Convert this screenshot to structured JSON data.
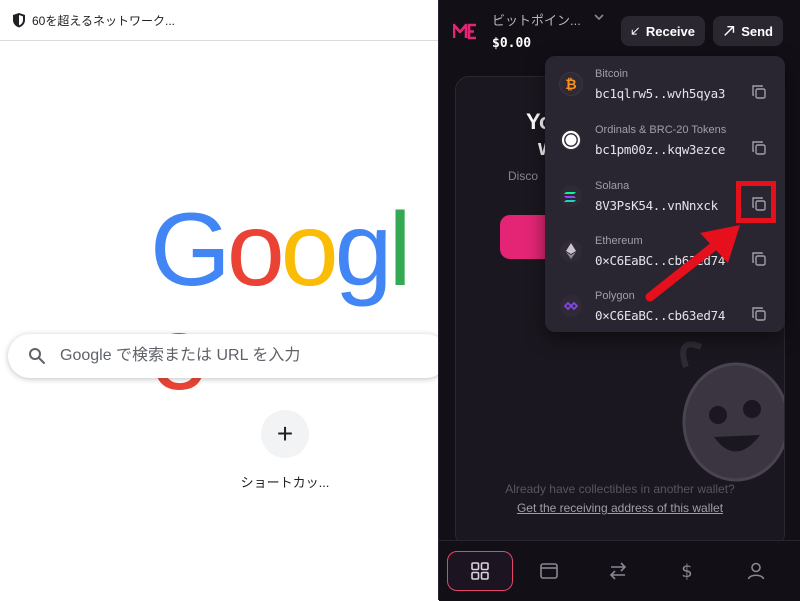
{
  "browser": {
    "tab_title": "60を超えるネットワーク...",
    "search_placeholder": "Google で検索または URL を入力",
    "logo_letters": [
      "G",
      "o",
      "o",
      "g",
      "l",
      "e"
    ],
    "logo_colors": [
      "#4285F4",
      "#EA4335",
      "#FBBC05",
      "#4285F4",
      "#34A853",
      "#EA4335"
    ],
    "shortcut_icon": "+",
    "shortcut_label": "ショートカッ..."
  },
  "wallet": {
    "account_name": "ビットポイン...",
    "balance": "$0.00",
    "receive_label": "Receive",
    "send_label": "Send",
    "brand_color": "#e42575",
    "card": {
      "title": "Yo",
      "title_line2": "w",
      "subtitle": "Disco",
      "note": "Already have collectibles in another wallet?",
      "link": "Get the receiving address of this wallet"
    },
    "addresses": [
      {
        "chain": "Bitcoin",
        "address": "bc1qlrw5..wvh5qya3",
        "icon": "bitcoin-icon",
        "color": "#f7931a"
      },
      {
        "chain": "Ordinals & BRC-20 Tokens",
        "address": "bc1pm00z..kqw3ezce",
        "icon": "ordinals-icon",
        "color": "#ffffff"
      },
      {
        "chain": "Solana",
        "address": "8V3PsK54..vnNnxck",
        "icon": "solana-icon",
        "color": "#9945ff"
      },
      {
        "chain": "Ethereum",
        "address": "0×C6EaBC..cb63ed74",
        "icon": "ethereum-icon",
        "color": "#c9c4d1"
      },
      {
        "chain": "Polygon",
        "address": "0×C6EaBC..cb63ed74",
        "icon": "polygon-icon",
        "color": "#8247e5"
      }
    ],
    "highlight_color": "#e5101c",
    "nav": [
      "grid-icon",
      "wallet-icon",
      "swap-icon",
      "dollar-icon",
      "profile-icon"
    ]
  }
}
